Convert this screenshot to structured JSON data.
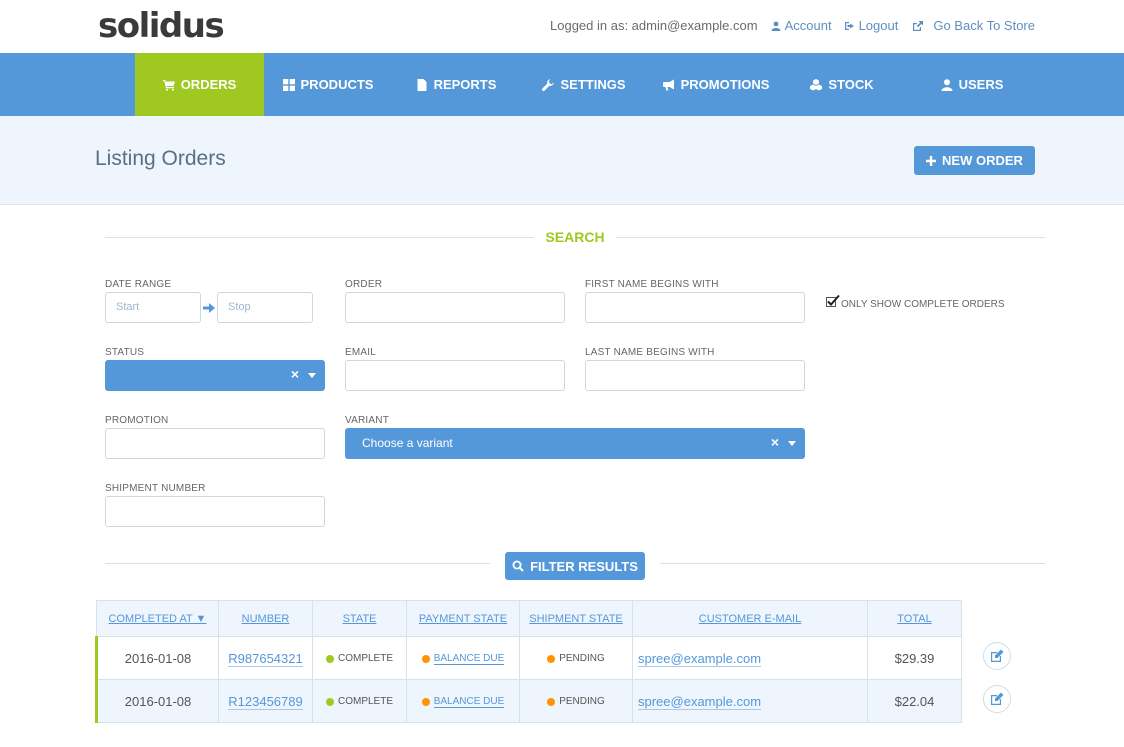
{
  "brand": {
    "logo": "solidus"
  },
  "header": {
    "login_text": "Logged in as: admin@example.com",
    "links": {
      "account": "Account",
      "logout": "Logout",
      "store": "Go Back To Store"
    }
  },
  "nav": {
    "orders": "ORDERS",
    "products": "PRODUCTS",
    "reports": "REPORTS",
    "settings": "SETTINGS",
    "promotions": "PROMOTIONS",
    "stock": "STOCK",
    "users": "USERS"
  },
  "page": {
    "title": "Listing Orders",
    "new_order": "NEW ORDER"
  },
  "search": {
    "title": "SEARCH",
    "date_range": {
      "label": "DATE RANGE",
      "start_placeholder": "Start",
      "stop_placeholder": "Stop"
    },
    "order_label": "ORDER",
    "first_name_label": "FIRST NAME BEGINS WITH",
    "complete_only": {
      "label": "ONLY SHOW COMPLETE ORDERS",
      "checked": true
    },
    "status_label": "STATUS",
    "email_label": "EMAIL",
    "last_name_label": "LAST NAME BEGINS WITH",
    "promotion_label": "PROMOTION",
    "variant": {
      "label": "VARIANT",
      "placeholder": "Choose a variant"
    },
    "shipment_label": "SHIPMENT NUMBER",
    "filter_button": "FILTER RESULTS"
  },
  "table": {
    "headers": {
      "completed_at": "COMPLETED AT ▼",
      "number": "NUMBER",
      "state": "STATE",
      "payment_state": "PAYMENT STATE",
      "shipment_state": "SHIPMENT STATE",
      "email": "CUSTOMER E-MAIL",
      "total": "TOTAL"
    },
    "rows": [
      {
        "completed_at": "2016-01-08",
        "number": "R987654321",
        "state": "COMPLETE",
        "payment_state": "BALANCE DUE",
        "shipment_state": "PENDING",
        "email": "spree@example.com",
        "total": "$29.39"
      },
      {
        "completed_at": "2016-01-08",
        "number": "R123456789",
        "state": "COMPLETE",
        "payment_state": "BALANCE DUE",
        "shipment_state": "PENDING",
        "email": "spree@example.com",
        "total": "$22.04"
      }
    ]
  },
  "colors": {
    "primary": "#5498da",
    "accent": "#9fc820",
    "warning": "#ff9300",
    "bg_light": "#eff5fc"
  },
  "icons": [
    "user-icon",
    "logout-icon",
    "external-link-icon",
    "cart-icon",
    "grid-icon",
    "file-icon",
    "wrench-icon",
    "bullhorn-icon",
    "cubes-icon",
    "user-icon",
    "plus-icon",
    "arrow-right-icon",
    "check-icon",
    "search-icon",
    "edit-icon"
  ]
}
